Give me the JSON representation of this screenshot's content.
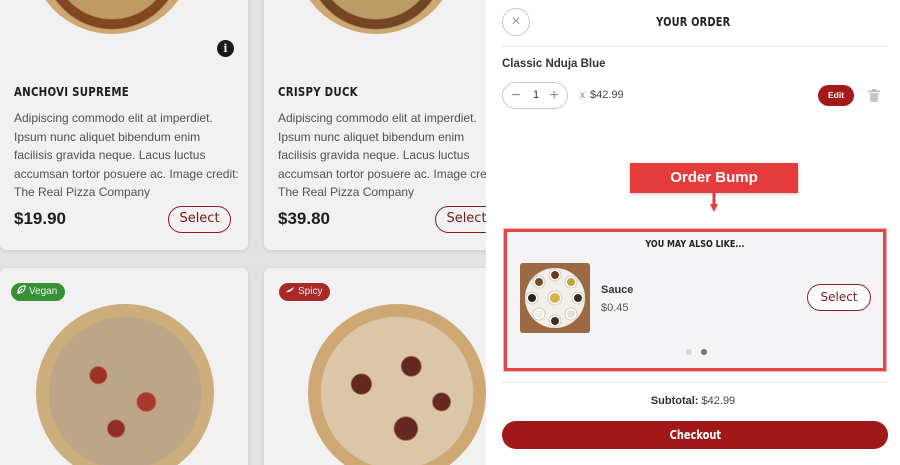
{
  "menu": {
    "cards": [
      {
        "title": "ANCHOVI SUPREME",
        "description": "Adipiscing commodo elit at imperdiet. Ipsum nunc aliquet bibendum enim facilisis gravida neque. Lacus luctus accumsan tortor posuere ac. Image credit: The Real Pizza Company",
        "price": "$19.90",
        "select_label": "Select",
        "info_icon": "i"
      },
      {
        "title": "CRISPY DUCK",
        "description": "Adipiscing commodo elit at imperdiet. Ipsum nunc aliquet bibendum enim facilisis gravida neque. Lacus luctus accumsan tortor posuere ac. Image credit: The Real Pizza Company",
        "price": "$39.80",
        "select_label": "Select"
      },
      {
        "badge": "Vegan",
        "badge_icon": "leaf-icon",
        "badge_color": "#3a9a3a"
      },
      {
        "badge": "Spicy",
        "badge_icon": "chili-icon",
        "badge_color": "#b32a2a"
      }
    ]
  },
  "panel": {
    "title": "YOUR ORDER",
    "close_icon": "×",
    "item": {
      "name": "Classic Nduja Blue",
      "quantity": "1",
      "minus": "−",
      "plus": "+",
      "times": "x",
      "price": "$42.99",
      "edit_label": "Edit"
    },
    "annotation": "Order Bump",
    "upsell": {
      "heading": "YOU MAY ALSO LIKE...",
      "name": "Sauce",
      "price": "$0.45",
      "select_label": "Select",
      "active_dot": 2
    },
    "subtotal_label": "Subtotal:",
    "subtotal_value": "$42.99",
    "checkout_label": "Checkout"
  },
  "colors": {
    "brand": "#a01818",
    "annotation": "#e53b3b",
    "vegan": "#3a9a3a",
    "spicy": "#b32a2a"
  }
}
